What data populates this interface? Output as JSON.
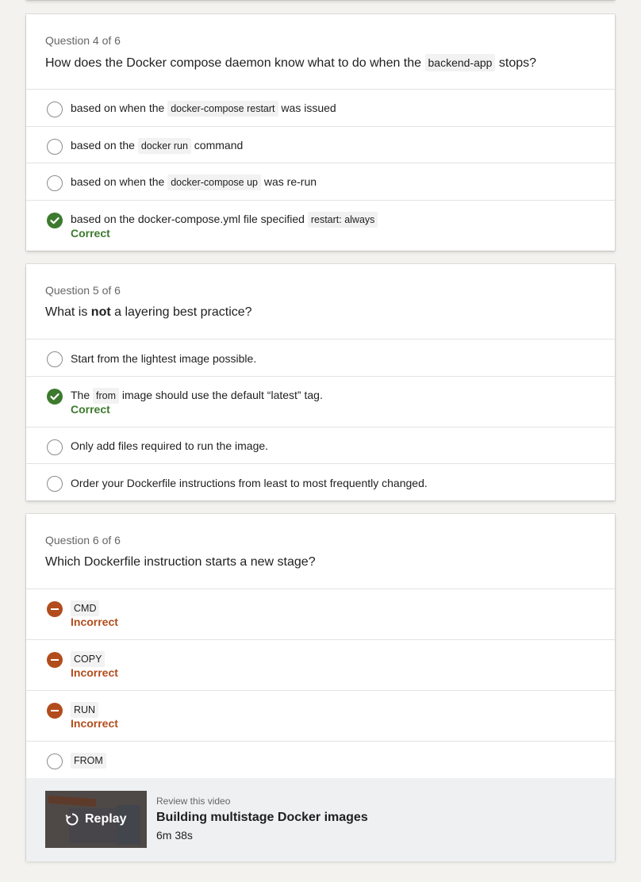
{
  "questions": [
    {
      "count": "Question 4 of 6",
      "text_before": "How does the Docker compose daemon know what to do when the ",
      "text_code": "backend-app",
      "text_after": " stops?",
      "options": [
        {
          "before": "based on when the ",
          "code": "docker-compose restart",
          "after": " was issued"
        },
        {
          "before": "based on the ",
          "code": "docker run",
          "after": " command"
        },
        {
          "before": "based on when the ",
          "code": "docker-compose up",
          "after": " was re-run"
        },
        {
          "before": "based on the docker-compose.yml file specified ",
          "code": "restart: always",
          "after": "",
          "feedback": "Correct"
        }
      ]
    },
    {
      "count": "Question 5 of 6",
      "text_before": "What is ",
      "text_bold": "not",
      "text_after": " a layering best practice?",
      "options": [
        {
          "text": "Start from the lightest image possible."
        },
        {
          "before": "The ",
          "code": "from",
          "after": " image should use the default “latest” tag.",
          "feedback": "Correct"
        },
        {
          "text": "Only add files required to run the image."
        },
        {
          "text": "Order your Dockerfile instructions from least to most frequently changed."
        }
      ]
    },
    {
      "count": "Question 6 of 6",
      "text": "Which Dockerfile instruction starts a new stage?",
      "options": [
        {
          "code": "CMD",
          "feedback": "Incorrect"
        },
        {
          "code": "COPY",
          "feedback": "Incorrect"
        },
        {
          "code": "RUN",
          "feedback": "Incorrect"
        },
        {
          "code": "FROM"
        }
      ]
    }
  ],
  "review": {
    "replay_label": "Replay",
    "label": "Review this video",
    "title": "Building multistage Docker images",
    "duration": "6m 38s"
  },
  "colors": {
    "correct": "#3d7a2e",
    "incorrect": "#b24c1d"
  },
  "icons": {
    "correct": "check-circle-icon",
    "incorrect": "no-entry-icon",
    "unselected": "radio-icon",
    "replay": "replay-icon"
  }
}
